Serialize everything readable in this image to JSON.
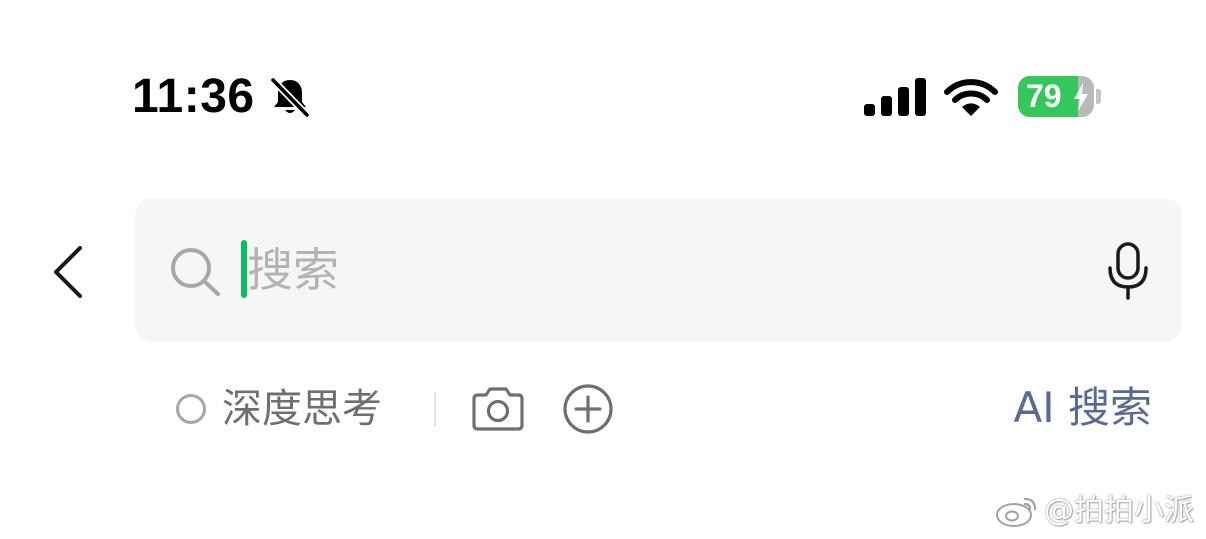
{
  "status_bar": {
    "time": "11:36",
    "battery_percent": "79",
    "battery_level": 0.79,
    "battery_color": "#34c759",
    "icons": [
      "bell-slash-icon",
      "cellular-signal-icon",
      "wifi-icon",
      "battery-charging-icon"
    ]
  },
  "search": {
    "placeholder": "搜索",
    "value": "",
    "icons": [
      "back-chevron-icon",
      "search-icon",
      "microphone-icon"
    ],
    "caret_color": "#07c160"
  },
  "toolbar": {
    "deep_think_label": "深度思考",
    "deep_think_selected": false,
    "ai_search_label": "AI 搜索",
    "ai_search_color": "#576b95",
    "icons": [
      "camera-icon",
      "plus-circle-icon"
    ]
  },
  "watermark": {
    "text": "@拍拍小派",
    "icon": "weibo-logo-icon"
  }
}
